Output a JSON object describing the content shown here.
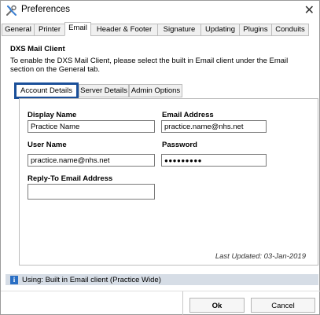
{
  "window": {
    "title": "Preferences",
    "close_glyph": "✕"
  },
  "tabs": [
    {
      "label": "General"
    },
    {
      "label": "Printer"
    },
    {
      "label": "Email"
    },
    {
      "label": "Header & Footer"
    },
    {
      "label": "Signature"
    },
    {
      "label": "Updating"
    },
    {
      "label": "Plugins"
    },
    {
      "label": "Conduits"
    }
  ],
  "active_tab": "Email",
  "section": {
    "heading": "DXS Mail Client",
    "description": "To enable the DXS Mail Client, please select the built in Email client under the Email section on the General tab."
  },
  "subtabs": [
    {
      "label": "Account Details"
    },
    {
      "label": "Server Details"
    },
    {
      "label": "Admin Options"
    }
  ],
  "active_subtab": "Account Details",
  "form": {
    "display_name_label": "Display Name",
    "display_name_value": "Practice Name",
    "email_address_label": "Email Address",
    "email_address_value": "practice.name@nhs.net",
    "user_name_label": "User Name",
    "user_name_value": "practice.name@nhs.net",
    "password_label": "Password",
    "password_value": "●●●●●●●●●",
    "reply_to_label": "Reply-To Email Address",
    "reply_to_value": ""
  },
  "last_updated": "Last Updated: 03-Jan-2019",
  "status": {
    "icon": "info-icon",
    "text": "Using: Built in Email client (Practice Wide)"
  },
  "buttons": {
    "ok": "Ok",
    "cancel": "Cancel"
  },
  "colors": {
    "accent": "#1a4f99",
    "status_bg": "#d6dde6",
    "info_icon": "#2a6fc4"
  }
}
